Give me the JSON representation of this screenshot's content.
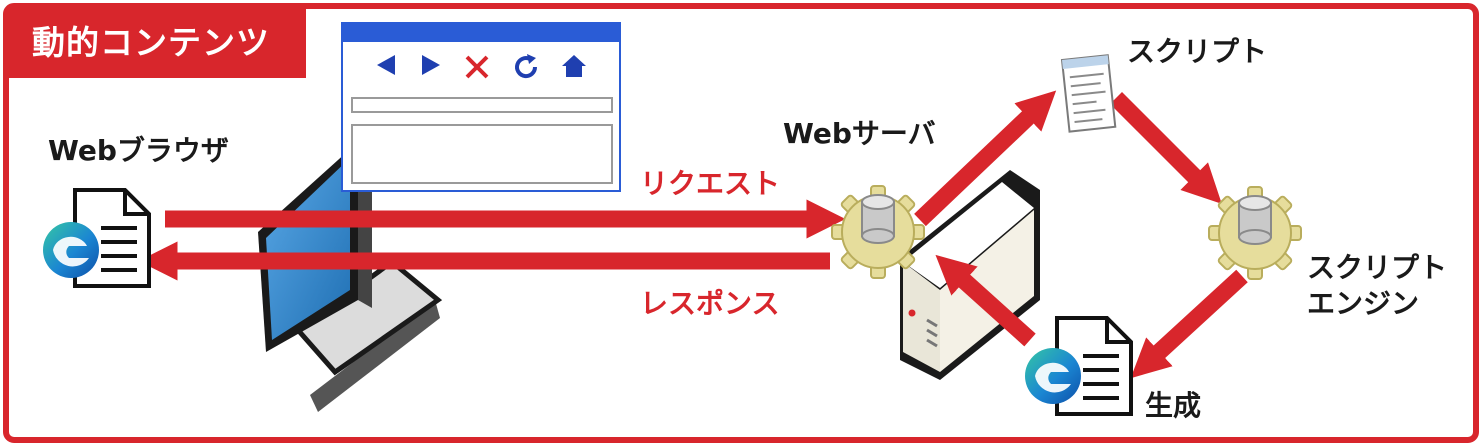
{
  "title": "動的コンテンツ",
  "browser": {
    "label": "Webブラウザ"
  },
  "arrows": {
    "request": "リクエスト",
    "response": "レスポンス"
  },
  "nodes": {
    "web_server": "Webサーバ",
    "script": "スクリプト",
    "script_engine_line1": "スクリプト",
    "script_engine_line2": "エンジン",
    "generated": "生成"
  },
  "colors": {
    "accent_red": "#d8262c",
    "browser_blue": "#2a5cd6",
    "monitor_screen": "#3b8fd0"
  },
  "icons": {
    "client_document": "edge-document-icon",
    "generated_document": "edge-document-icon",
    "script_file": "notepad-file-icon",
    "server_gear": "gear-cylinder-icon",
    "engine_gear": "gear-cylinder-icon"
  }
}
